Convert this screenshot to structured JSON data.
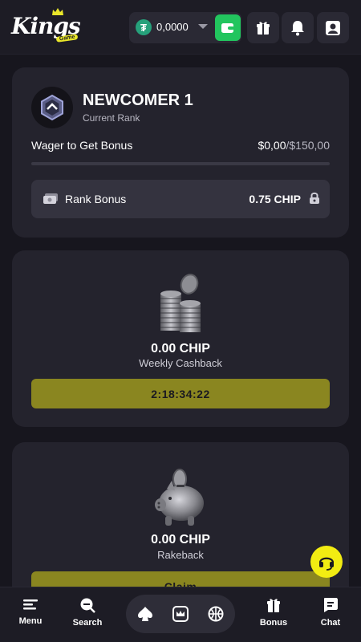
{
  "header": {
    "logo_text": "Kings",
    "logo_sub": "Game",
    "balance": "0,0000",
    "currency_icon": "tether-icon"
  },
  "rank": {
    "title": "NEWCOMER 1",
    "subtitle": "Current Rank",
    "wager_label": "Wager to Get Bonus",
    "wager_current": "$0,00",
    "wager_target": "/$150,00",
    "progress_fraction": 0,
    "bonus_label": "Rank Bonus",
    "bonus_value": "0.75 CHIP"
  },
  "cashback": {
    "amount": "0.00 CHIP",
    "label": "Weekly Cashback",
    "timer": "2:18:34:22"
  },
  "rakeback": {
    "amount": "0.00 CHIP",
    "label": "Rakeback",
    "button": "Claim"
  },
  "nav": {
    "menu": "Menu",
    "search": "Search",
    "bonus": "Bonus",
    "chat": "Chat"
  },
  "colors": {
    "background": "#17161e",
    "card": "#24232d",
    "accent_yellow": "#f2ec12",
    "button_olive": "#8a8620",
    "wallet_green": "#22c55e"
  }
}
